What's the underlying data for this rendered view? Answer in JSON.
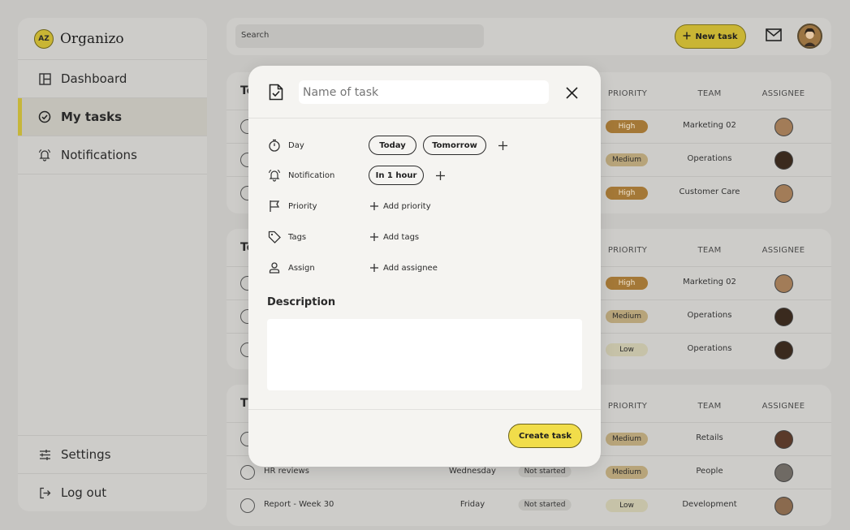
{
  "app": {
    "name": "Organizo",
    "logo_text": "AZ"
  },
  "sidebar": {
    "items": [
      {
        "label": "Dashboard",
        "icon": "dashboard-icon"
      },
      {
        "label": "My tasks",
        "icon": "check-circle-icon",
        "active": true
      },
      {
        "label": "Notifications",
        "icon": "bell-icon"
      }
    ],
    "bottom": [
      {
        "label": "Settings",
        "icon": "sliders-icon"
      },
      {
        "label": "Log out",
        "icon": "logout-icon"
      }
    ]
  },
  "topbar": {
    "search_placeholder": "Search",
    "new_task_label": "New task"
  },
  "table_headers": {
    "priority": "PRIORITY",
    "team": "TEAM",
    "assignee": "ASSIGNEE"
  },
  "cards": [
    {
      "title": "To",
      "rows": [
        {
          "priority": "High",
          "team": "Marketing 02"
        },
        {
          "priority": "Medium",
          "team": "Operations"
        },
        {
          "priority": "High",
          "team": "Customer Care"
        }
      ]
    },
    {
      "title": "To",
      "rows": [
        {
          "priority": "High",
          "team": "Marketing 02"
        },
        {
          "priority": "Medium",
          "team": "Operations"
        },
        {
          "priority": "Low",
          "team": "Operations"
        }
      ]
    },
    {
      "title": "Th",
      "rows": [
        {
          "name": "",
          "day": "",
          "status": "",
          "priority": "Medium",
          "team": "Retails"
        },
        {
          "name": "HR reviews",
          "day": "Wednesday",
          "status": "Not started",
          "priority": "Medium",
          "team": "People"
        },
        {
          "name": "Report - Week 30",
          "day": "Friday",
          "status": "Not started",
          "priority": "Low",
          "team": "Development"
        }
      ]
    }
  ],
  "modal": {
    "name_placeholder": "Name of task",
    "props": {
      "day": "Day",
      "notification": "Notification",
      "priority": "Priority",
      "tags": "Tags",
      "assign": "Assign"
    },
    "day_chips": [
      "Today",
      "Tomorrow"
    ],
    "notification_chips": [
      "In 1 hour"
    ],
    "add_priority": "Add priority",
    "add_tags": "Add tags",
    "add_assignee": "Add assignee",
    "description_label": "Description",
    "create_label": "Create task"
  }
}
